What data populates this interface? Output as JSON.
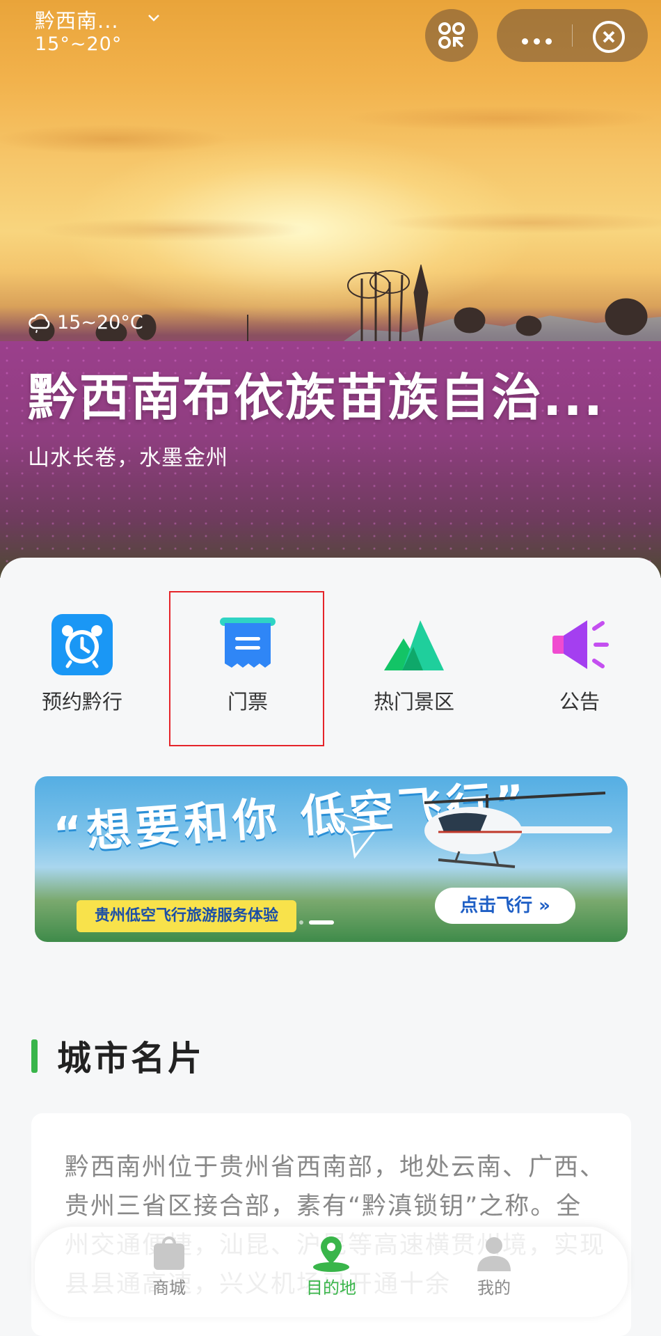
{
  "header": {
    "city": "黔西南...",
    "temp": "15°~20°"
  },
  "hero": {
    "weather": "15~20°C",
    "title": "黔西南布依族苗族自治...",
    "subtitle": "山水长卷，水墨金州"
  },
  "quick_nav": [
    {
      "label": "预约黔行",
      "icon": "alarm-clock-icon"
    },
    {
      "label": "门票",
      "icon": "ticket-icon"
    },
    {
      "label": "热门景区",
      "icon": "mountain-icon"
    },
    {
      "label": "公告",
      "icon": "megaphone-icon"
    }
  ],
  "banner": {
    "quote": "“想要和你 低空飞行”",
    "tag": "贵州低空飞行旅游服务体验",
    "cta": "点击飞行 »"
  },
  "section": {
    "title": "城市名片"
  },
  "intro": {
    "text": "黔西南州位于贵州省西南部，地处云南、广西、贵州三省区接合部，素有“黔滇锁钥”之称。全州交通便捷，汕昆、沪昆等高速横贯州境，实现县县通高速，兴义机场已开通十余"
  },
  "tabbar": [
    {
      "label": "商城",
      "icon": "shopping-bag-icon"
    },
    {
      "label": "目的地",
      "icon": "location-pin-icon"
    },
    {
      "label": "我的",
      "icon": "user-icon"
    }
  ],
  "colors": {
    "accent": "#39b54a",
    "highlight_box": "#e5242a"
  }
}
